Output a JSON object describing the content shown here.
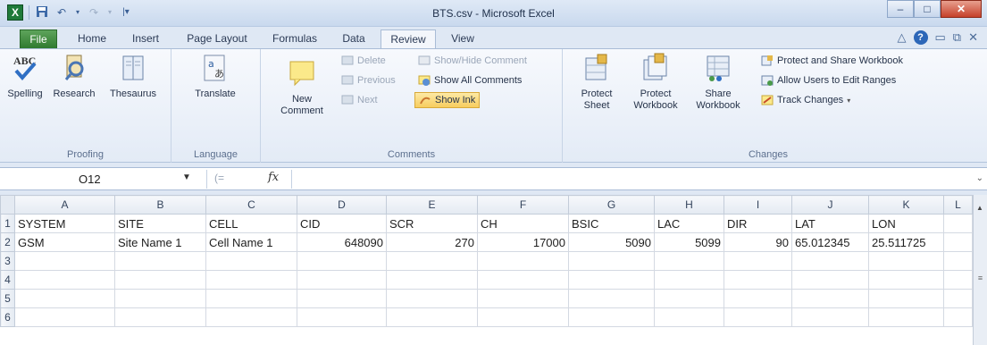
{
  "window": {
    "title": "BTS.csv - Microsoft Excel"
  },
  "qat": {
    "app_icon": "X",
    "save_icon": "save-icon",
    "undo_icon": "undo-icon",
    "redo_icon": "redo-icon"
  },
  "window_buttons": {
    "minimize": "–",
    "maximize": "□",
    "close": "✕"
  },
  "tabs": [
    "File",
    "Home",
    "Insert",
    "Page Layout",
    "Formulas",
    "Data",
    "Review",
    "View"
  ],
  "active_tab": "Review",
  "ribbon": {
    "proofing": {
      "spelling": "Spelling",
      "research": "Research",
      "thesaurus": "Thesaurus",
      "label": "Proofing"
    },
    "language": {
      "translate": "Translate",
      "label": "Language"
    },
    "comments": {
      "new_comment_line1": "New",
      "new_comment_line2": "Comment",
      "delete": "Delete",
      "previous": "Previous",
      "next": "Next",
      "show_hide": "Show/Hide Comment",
      "show_all": "Show All Comments",
      "show_ink": "Show Ink",
      "label": "Comments"
    },
    "changes": {
      "protect_sheet_line1": "Protect",
      "protect_sheet_line2": "Sheet",
      "protect_workbook_line1": "Protect",
      "protect_workbook_line2": "Workbook",
      "share_workbook_line1": "Share",
      "share_workbook_line2": "Workbook",
      "protect_share": "Protect and Share Workbook",
      "allow_users": "Allow Users to Edit Ranges",
      "track_changes": "Track Changes",
      "label": "Changes"
    }
  },
  "formula_bar": {
    "name_box": "O12",
    "fx": "fx",
    "value": ""
  },
  "grid": {
    "columns": [
      "A",
      "B",
      "C",
      "D",
      "E",
      "F",
      "G",
      "H",
      "I",
      "J",
      "K",
      "L"
    ],
    "rows": [
      {
        "num": "1",
        "cells": [
          "SYSTEM",
          "SITE",
          "CELL",
          "CID",
          "SCR",
          "CH",
          "BSIC",
          "LAC",
          "DIR",
          "LAT",
          "LON",
          ""
        ]
      },
      {
        "num": "2",
        "cells": [
          "GSM",
          "Site Name 1",
          "Cell Name 1",
          "648090",
          "270",
          "17000",
          "5090",
          "5099",
          "90",
          "65.012345",
          "25.511725",
          ""
        ]
      },
      {
        "num": "3",
        "cells": [
          "",
          "",
          "",
          "",
          "",
          "",
          "",
          "",
          "",
          "",
          "",
          ""
        ]
      },
      {
        "num": "4",
        "cells": [
          "",
          "",
          "",
          "",
          "",
          "",
          "",
          "",
          "",
          "",
          "",
          ""
        ]
      },
      {
        "num": "5",
        "cells": [
          "",
          "",
          "",
          "",
          "",
          "",
          "",
          "",
          "",
          "",
          "",
          ""
        ]
      },
      {
        "num": "6",
        "cells": [
          "",
          "",
          "",
          "",
          "",
          "",
          "",
          "",
          "",
          "",
          "",
          ""
        ]
      }
    ]
  }
}
